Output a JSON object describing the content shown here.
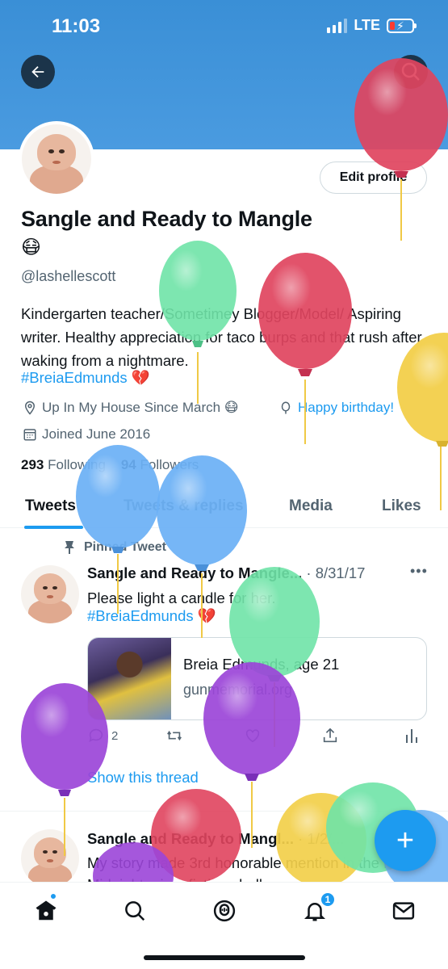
{
  "status_bar": {
    "time": "11:03",
    "network": "LTE"
  },
  "profile": {
    "name": "Sangle and Ready to Mangle",
    "name_emoji": "😷",
    "handle": "@lashellescott",
    "bio": "Kindergarten teacher/Sometimey Blogger/Model/ Aspiring writer. Healthy appreciation for taco burps and that rush after waking from a nightmare.",
    "bio_hashtag": "#BreiaEdmunds",
    "bio_hashtag_emoji": "💔",
    "location": "Up In My House Since March 😷",
    "birthday_link": "Happy birthday!",
    "joined": "Joined June 2016",
    "following_count": "293",
    "following_label": "Following",
    "followers_count": "94",
    "followers_label": "Followers",
    "edit_button": "Edit profile"
  },
  "tabs": [
    {
      "label": "Tweets"
    },
    {
      "label": "Tweets & replies"
    },
    {
      "label": "Media"
    },
    {
      "label": "Likes"
    }
  ],
  "pinned_tweet": {
    "pinned_label": "Pinned Tweet",
    "author": "Sangle and Ready to Mangle...",
    "date": "· 8/31/17",
    "text": "Please light a candle for her.",
    "hashtag": "#BreiaEdmunds",
    "hashtag_emoji": "💔",
    "card_title": "Breia Edmunds, age 21",
    "card_domain": "gunmemorial.org",
    "reply_count": "2",
    "show_thread": "Show this thread"
  },
  "second_tweet": {
    "author": "Sangle and Ready to Mangl...",
    "date": "· 1/2/...",
    "text": "My story made 3rd honorable mention in the NYC Midnight micro fiction challenge"
  },
  "fab_label": "+",
  "notification_badge": "1",
  "colors": {
    "accent": "#1d9bf0",
    "banner": "#4a9be0",
    "heart": "#e0245e",
    "balloon_red": "#e0445e",
    "balloon_green": "#6fe3a7",
    "balloon_blue": "#6ab0f5",
    "balloon_purple": "#9b45d8",
    "balloon_yellow": "#f2cf4a"
  },
  "icons": {
    "back": "arrow-left-icon",
    "search": "search-icon",
    "location": "location-pin-icon",
    "birthday": "balloon-icon",
    "calendar": "calendar-icon",
    "pin": "pin-icon",
    "reply": "reply-icon",
    "retweet": "retweet-icon",
    "like": "heart-icon",
    "share": "share-icon",
    "analytics": "analytics-icon",
    "home": "home-icon",
    "explore": "search-icon",
    "spaces": "spaces-icon",
    "notifications": "bell-icon",
    "messages": "mail-icon"
  }
}
